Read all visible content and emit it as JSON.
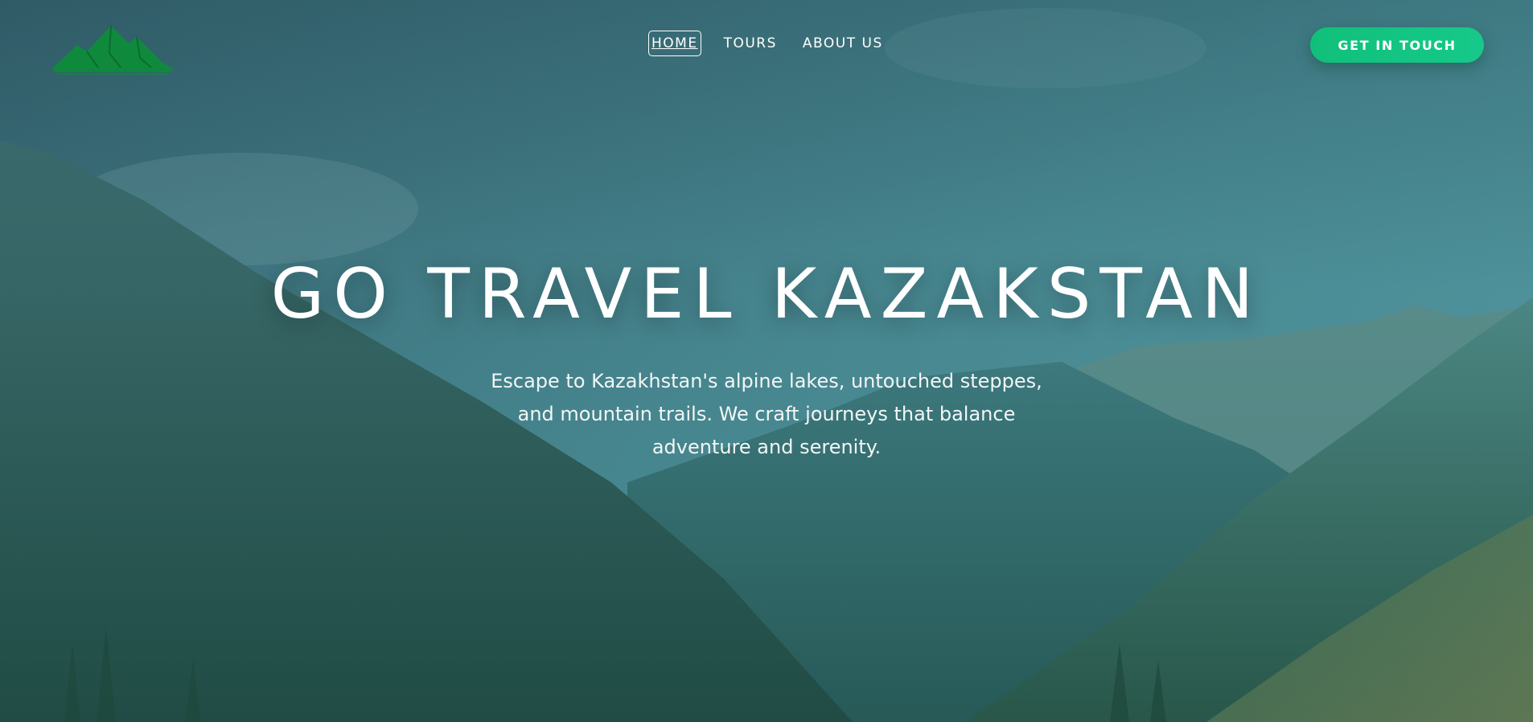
{
  "header": {
    "logo_icon": "mountain-logo-icon",
    "nav_items": [
      {
        "label": "HOME",
        "active": true
      },
      {
        "label": "TOURS",
        "active": false
      },
      {
        "label": "ABOUT US",
        "active": false
      }
    ],
    "cta_label": "GET IN TOUCH"
  },
  "hero": {
    "title": "GO TRAVEL KAZAKSTAN",
    "subtitle": "Escape to Kazakhstan's alpine lakes, untouched steppes, and mountain trails. We craft journeys that balance adventure and serenity.",
    "background_image": "mountain-valley-landscape"
  },
  "colors": {
    "accent": "#10c07a",
    "logo": "#0f8a3c",
    "text": "#ffffff",
    "overlay": "#2f6a70"
  }
}
